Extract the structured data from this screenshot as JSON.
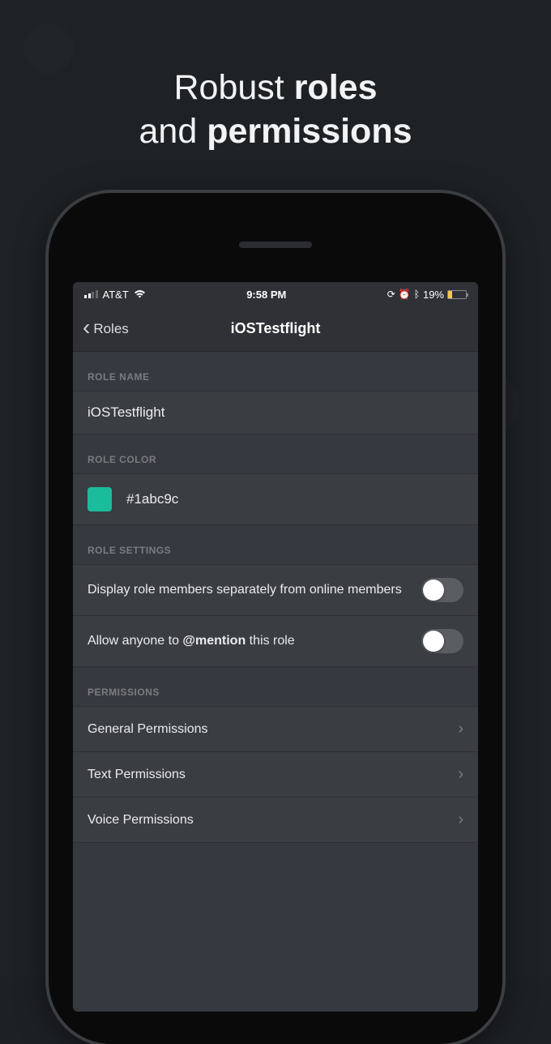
{
  "marketing": {
    "line1a": "Robust ",
    "line1b": "roles",
    "line2a": "and ",
    "line2b": "permissions"
  },
  "status": {
    "carrier": "AT&T",
    "time": "9:58 PM",
    "battery_pct": "19%",
    "wifi": true,
    "icons": "⊕ ⭘ ✳"
  },
  "nav": {
    "back_label": "Roles",
    "title": "iOSTestflight"
  },
  "sections": {
    "role_name": {
      "header": "ROLE NAME",
      "value": "iOSTestflight"
    },
    "role_color": {
      "header": "ROLE COLOR",
      "hex": "#1abc9c"
    },
    "role_settings": {
      "header": "ROLE SETTINGS",
      "items": [
        {
          "label": "Display role members separately from online members",
          "on": false
        },
        {
          "label_pre": "Allow anyone to ",
          "mention": "@mention",
          "label_post": " this role",
          "on": false
        }
      ]
    },
    "permissions": {
      "header": "PERMISSIONS",
      "items": [
        {
          "label": "General Permissions"
        },
        {
          "label": "Text Permissions"
        },
        {
          "label": "Voice Permissions"
        }
      ]
    }
  }
}
